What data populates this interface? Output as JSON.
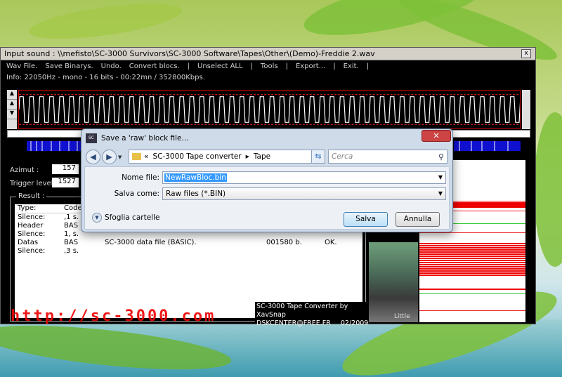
{
  "window": {
    "title": "Input sound : \\\\mefisto\\SC-3000 Survivors\\SC-3000 Software\\Tapes\\Other\\(Demo)-Freddie 2.wav",
    "close": "x"
  },
  "menu": [
    "Wav File.",
    "Save Binarys.",
    "Undo.",
    "Convert blocs.",
    "|",
    "Unselect ALL",
    "|",
    "Tools",
    "|",
    "Export...",
    "|",
    "Exit.",
    "|"
  ],
  "info": "Info: 22050Hz - mono - 16 bits - 00:22mn / 352800Kbps.",
  "azimut": {
    "label": "Azimut :",
    "value": "157"
  },
  "trigger": {
    "label": "Trigger level :",
    "value": "1527"
  },
  "result": {
    "legend": "Result :",
    "headers": [
      "Type:",
      "Code"
    ],
    "rows": [
      [
        "Silence:",
        ",1 s.",
        "",
        "",
        ""
      ],
      [
        "Header",
        "BAS",
        "",
        "",
        ""
      ],
      [
        "Silence:",
        "1, s.",
        "",
        "",
        ""
      ],
      [
        "Datas",
        "BAS",
        "SC-3000 data file (BASIC).",
        "001580 b.",
        "OK."
      ],
      [
        "Silence:",
        ",3 s.",
        "",
        "",
        ""
      ]
    ]
  },
  "logo_text": "http://sc-3000.com",
  "credit": [
    "SC-3000 Tape Converter by XavSnap",
    "DSKCENTER@FREE.FR",
    "02/2009"
  ],
  "photo_caption": "Little",
  "dialog": {
    "title": "Save a 'raw' block file...",
    "breadcrumb": [
      "«",
      "SC-3000 Tape converter",
      "▸",
      "Tape"
    ],
    "search_placeholder": "Cerca",
    "filename_label": "Nome file:",
    "filename_value": "NewRawBloc.bin",
    "savetype_label": "Salva come:",
    "savetype_value": "Raw files  (*.BIN)",
    "browse_label": "Sfoglia cartelle",
    "save_button": "Salva",
    "cancel_button": "Annulla"
  },
  "colors": {
    "wave": "#ff2020",
    "blocks": "#1010d0",
    "dialog_accent": "#3c7fb1"
  }
}
